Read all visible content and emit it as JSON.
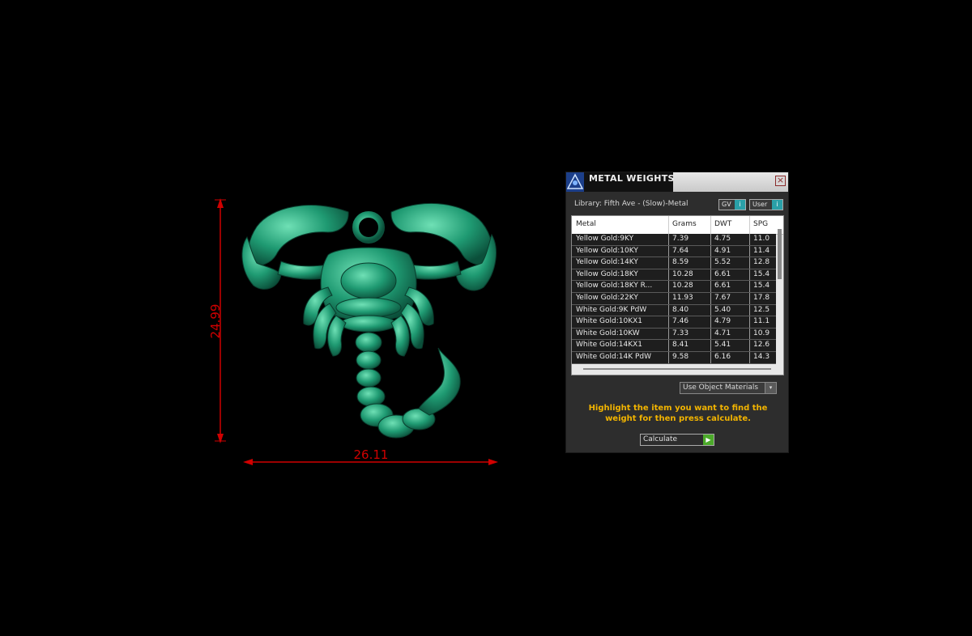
{
  "dimensions": {
    "height_label": "24.99",
    "width_label": "26.11",
    "color": "#d00000"
  },
  "model": {
    "color": "#1f9a72"
  },
  "panel": {
    "title": "METAL WEIGHTS",
    "close_label": "×",
    "library_label": "Library: Fifth Ave - (Slow)-Metal",
    "gv_label": "GV",
    "user_label": "User",
    "columns": [
      "Metal",
      "Grams",
      "DWT",
      "SPG"
    ],
    "rows": [
      {
        "metal": "Yellow Gold:9KY",
        "grams": "7.39",
        "dwt": "4.75",
        "spg": "11.0"
      },
      {
        "metal": "Yellow Gold:10KY",
        "grams": "7.64",
        "dwt": "4.91",
        "spg": "11.4"
      },
      {
        "metal": "Yellow Gold:14KY",
        "grams": "8.59",
        "dwt": "5.52",
        "spg": "12.8"
      },
      {
        "metal": "Yellow Gold:18KY",
        "grams": "10.28",
        "dwt": "6.61",
        "spg": "15.4"
      },
      {
        "metal": "Yellow Gold:18KY R...",
        "grams": "10.28",
        "dwt": "6.61",
        "spg": "15.4"
      },
      {
        "metal": "Yellow Gold:22KY",
        "grams": "11.93",
        "dwt": "7.67",
        "spg": "17.8"
      },
      {
        "metal": "White Gold:9K PdW",
        "grams": "8.40",
        "dwt": "5.40",
        "spg": "12.5"
      },
      {
        "metal": "White Gold:10KX1",
        "grams": "7.46",
        "dwt": "4.79",
        "spg": "11.1"
      },
      {
        "metal": "White Gold:10KW",
        "grams": "7.33",
        "dwt": "4.71",
        "spg": "10.9"
      },
      {
        "metal": "White Gold:14KX1",
        "grams": "8.41",
        "dwt": "5.41",
        "spg": "12.6"
      },
      {
        "metal": "White Gold:14K PdW",
        "grams": "9.58",
        "dwt": "6.16",
        "spg": "14.3"
      }
    ],
    "materials_dropdown": "Use Object Materials",
    "hint": "Highlight the item you want to find the weight for then press calculate.",
    "calculate_label": "Calculate",
    "accent_color": "#f2b400"
  }
}
